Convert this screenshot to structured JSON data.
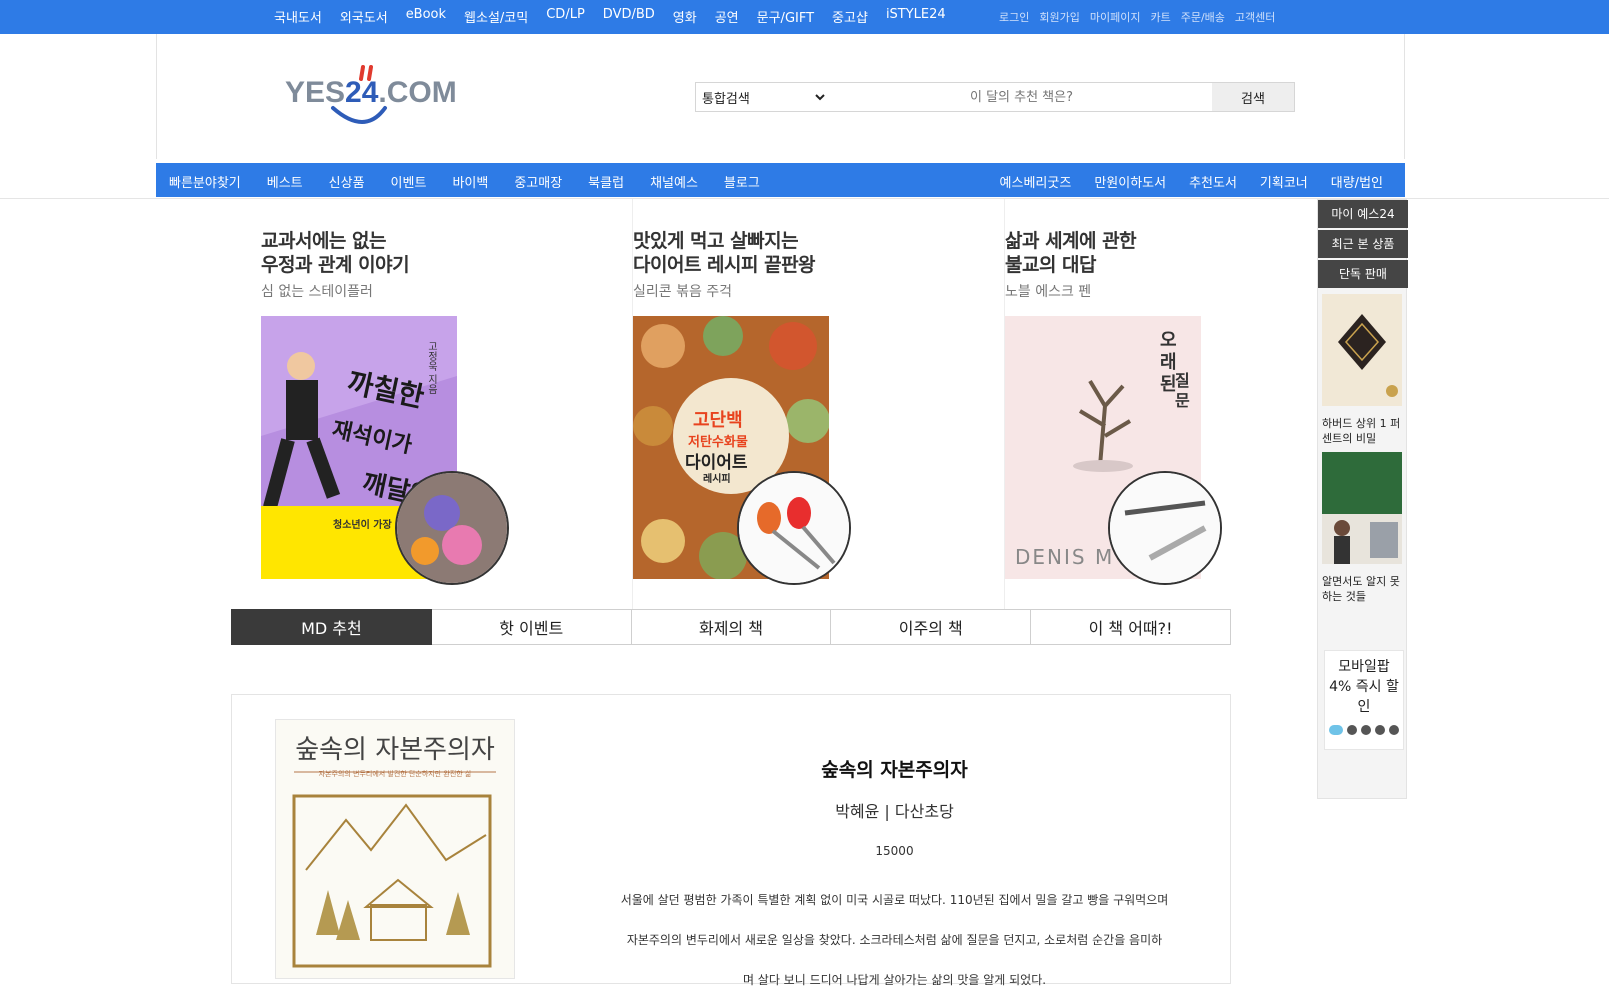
{
  "topnav": {
    "items": [
      "국내도서",
      "외국도서",
      "eBook",
      "웹소설/코믹",
      "CD/LP",
      "DVD/BD",
      "영화",
      "공연",
      "문구/GIFT",
      "중고샵",
      "iSTYLE24"
    ],
    "util": [
      "로그인",
      "회원가입",
      "마이페이지",
      "카트",
      "주문/배송",
      "고객센터"
    ]
  },
  "header": {
    "logo_text": "YES24.COM",
    "search": {
      "scope": "통합검색",
      "placeholder": "이 달의 추천 책은?",
      "button": "검색"
    }
  },
  "mainnav": {
    "left": [
      "빠른분야찾기",
      "베스트",
      "신상품",
      "이벤트",
      "바이백",
      "중고매장",
      "북클럽",
      "채널예스",
      "블로그"
    ],
    "right": [
      "예스베리굿즈",
      "만원이하도서",
      "추천도서",
      "기획코너",
      "대량/법인"
    ]
  },
  "banners": [
    {
      "title1": "교과서에는 없는",
      "title2": "우정과 관계 이야기",
      "sub": "심 없는 스테이플러",
      "cover_text": "까칠한 재석이가 깨달았다",
      "cover_band": "청소년이 가장 <까칠한 재석이",
      "author": "고정욱 지음"
    },
    {
      "title1": "맛있게 먹고 살빠지는",
      "title2": "다이어트 레시피 끝판왕",
      "sub": "실리콘 볶음 주걱",
      "cover_text": "고단백 저탄수화물 다이어트 레시피",
      "cover_band": ""
    },
    {
      "title1": "삶과 세계에 관한",
      "title2": "불교의 대답",
      "sub": "노블 에스크 펜",
      "cover_text": "오래된 질문",
      "cover_band": "DENIS M"
    }
  ],
  "tabs": [
    "MD 추천",
    "핫 이벤트",
    "화제의 책",
    "이주의 책",
    "이 책 어때?!"
  ],
  "featured": {
    "cover_title": "숲속의 자본주의자",
    "cover_sub": "자본주의의 변두리에서 발견한 단순하지만 완전한 삶",
    "title": "숲속의 자본주의자",
    "author": "박혜윤 | 다산초당",
    "price": "15000",
    "desc": [
      "서울에 살던 평범한 가족이 특별한 계획 없이 미국 시골로 떠났다. 110년된 집에서 밀을 갈고 빵을 구워먹으며",
      "자본주의의 변두리에서 새로운 일상을 찾았다. 소크라테스처럼 삶에 질문을 던지고, 소로처럼 순간을 음미하",
      "며 살다 보니 드디어 나답게 살아가는 삶의 맛을 알게 되었다."
    ]
  },
  "sidebar": {
    "buttons": [
      "마이 예스24",
      "최근 본 상품",
      "단독 판매"
    ],
    "books": [
      {
        "caption": "하버드 상위 1 퍼센트의 비밀"
      },
      {
        "caption": "알면서도 알지 못하는 것들"
      }
    ],
    "mobile": "모바일팝 4% 즉시 할인"
  },
  "colors": {
    "brand": "#2e7be6",
    "tab_active": "#3a3a3a",
    "dot_active": "#6fc3e8"
  }
}
